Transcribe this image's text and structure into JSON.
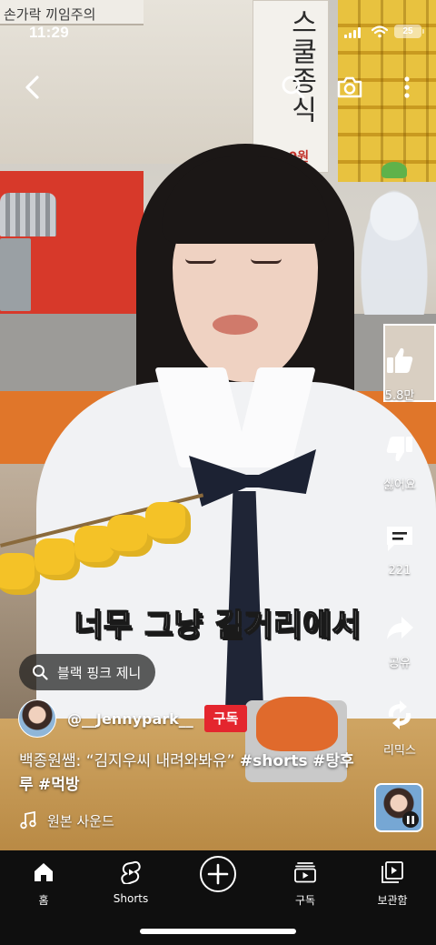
{
  "status_bar": {
    "time": "11:29",
    "battery": "25"
  },
  "background_text": {
    "shop_sign": "손가락 끼임주의",
    "banner": "스쿨종식",
    "banner_price": "500원"
  },
  "top_bar": {
    "back_icon": "chevron-left-icon",
    "search_icon": "search-icon",
    "camera_icon": "camera-icon",
    "more_icon": "more-vertical-icon"
  },
  "actions": {
    "like": {
      "icon": "thumbs-up-icon",
      "label": "5.8만"
    },
    "dislike": {
      "icon": "thumbs-down-icon",
      "label": "싫어요"
    },
    "comments": {
      "icon": "comment-icon",
      "label": "221"
    },
    "share": {
      "icon": "share-icon",
      "label": "공유"
    },
    "remix": {
      "icon": "remix-icon",
      "label": "리믹스"
    }
  },
  "caption": "너무 그냥 길거리에서",
  "search_chip": {
    "icon": "search-icon",
    "text": "블랙 핑크 제니"
  },
  "channel": {
    "name": "@__Jennypark__",
    "subscribe_label": "구독"
  },
  "video_title": {
    "text": "백종원쌤: “김지우씨 내려와봐유”",
    "tags": [
      "#shorts",
      "#탕후루",
      "#먹방"
    ]
  },
  "sound": {
    "icon": "music-note-icon",
    "label": "원본 사운드"
  },
  "bottom_nav": [
    {
      "icon": "home-icon",
      "label": "홈"
    },
    {
      "icon": "shorts-icon",
      "label": "Shorts"
    },
    {
      "icon": "create-plus-icon",
      "label": ""
    },
    {
      "icon": "subscriptions-icon",
      "label": "구독"
    },
    {
      "icon": "library-icon",
      "label": "보관함"
    }
  ],
  "colors": {
    "subscribe": "#e4262e",
    "nav_background": "#0f0f0f"
  }
}
